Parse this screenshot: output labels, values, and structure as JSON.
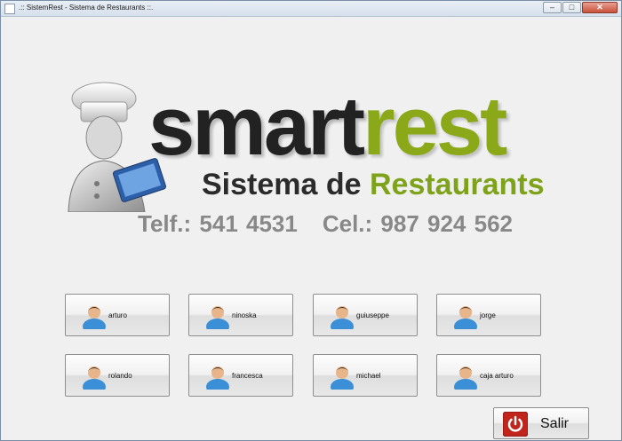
{
  "window": {
    "title": ".:: SistemRest - Sistema de Restaurants ::."
  },
  "logo": {
    "brand_part1": "smart",
    "brand_part2": "rest",
    "subtitle_part1": "Sistema de",
    "subtitle_part2": "Restaurants",
    "phone": "Telf.: 541 4531",
    "cell": "Cel.: 987 924 562"
  },
  "users": [
    {
      "label": "arturo"
    },
    {
      "label": "ninoska"
    },
    {
      "label": "guiuseppe"
    },
    {
      "label": "jorge"
    },
    {
      "label": "rolando"
    },
    {
      "label": "francesca"
    },
    {
      "label": "michael"
    },
    {
      "label": "caja arturo"
    }
  ],
  "exit": {
    "label": "Salir",
    "icon": "power-icon"
  },
  "colors": {
    "brand_dark": "#222222",
    "brand_green": "#8aa817",
    "phones": "#888888",
    "exit_red": "#c0241b"
  }
}
